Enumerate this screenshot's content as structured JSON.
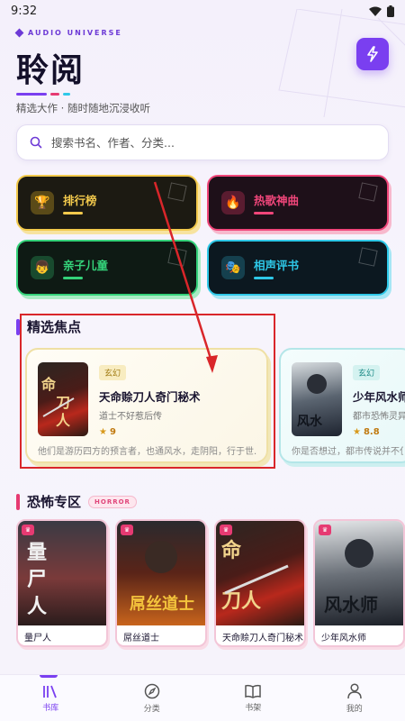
{
  "status_bar": {
    "time": "9:32"
  },
  "header": {
    "brand_tag": "AUDIO UNIVERSE",
    "app_title": "聆阅",
    "subtitle": "精选大作 · 随时随地沉浸收听",
    "flash_icon": "lightning-icon"
  },
  "search": {
    "placeholder": "搜索书名、作者、分类..."
  },
  "categories": [
    {
      "label": "排行榜",
      "icon": "trophy-icon",
      "color": "#f2c94c"
    },
    {
      "label": "热歌神曲",
      "icon": "fire-icon",
      "color": "#f0467a"
    },
    {
      "label": "亲子儿童",
      "icon": "child-icon",
      "color": "#34d27a"
    },
    {
      "label": "相声评书",
      "icon": "mask-icon",
      "color": "#2ec8e8"
    }
  ],
  "featured": {
    "title": "精选焦点",
    "items": [
      {
        "genre": "玄幻",
        "title": "天命赊刀人奇门秘术",
        "author": "道士不好惹后传",
        "rating": "9",
        "desc": "他们是游历四方的预言者，也通风水，走阴阳，行于世..."
      },
      {
        "genre": "玄幻",
        "title": "少年风水师",
        "author": "都市恐怖灵异",
        "rating": "8.8",
        "desc": "你是否想过，都市传说并不仅"
      }
    ]
  },
  "horror": {
    "title": "恐怖专区",
    "badge": "HORROR",
    "items": [
      {
        "title": "量尸人"
      },
      {
        "title": "屌丝道士"
      },
      {
        "title": "天命赊刀人奇门秘术"
      },
      {
        "title": "少年风水师"
      }
    ]
  },
  "nav": [
    {
      "label": "书库",
      "icon": "library-icon",
      "active": true
    },
    {
      "label": "分类",
      "icon": "compass-icon",
      "active": false
    },
    {
      "label": "书架",
      "icon": "book-icon",
      "active": false
    },
    {
      "label": "我的",
      "icon": "person-icon",
      "active": false
    }
  ],
  "colors": {
    "accent": "#7a3ff0",
    "horror_pink": "#e63a72",
    "annotation_red": "#d9262a"
  }
}
